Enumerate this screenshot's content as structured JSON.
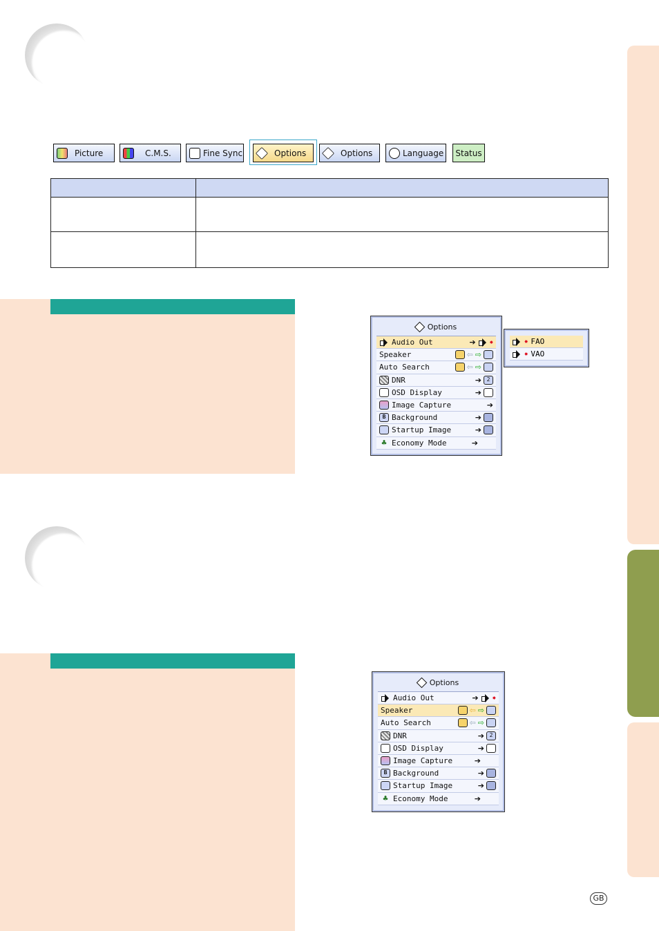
{
  "menu_tabs": {
    "picture": "Picture",
    "cms": "C.M.S.",
    "fine_sync": "Fine Sync",
    "options1": "Options",
    "options2": "Options",
    "language": "Language",
    "status": "Status"
  },
  "osd_top": {
    "title": "Options",
    "items": [
      {
        "label": "Audio Out"
      },
      {
        "label": "Speaker"
      },
      {
        "label": "Auto Search"
      },
      {
        "label": "DNR",
        "value": "2"
      },
      {
        "label": "OSD Display"
      },
      {
        "label": "Image Capture"
      },
      {
        "label": "Background",
        "value": "B"
      },
      {
        "label": "Startup Image"
      },
      {
        "label": "Economy Mode"
      }
    ],
    "submenu": [
      "FAO",
      "VAO"
    ]
  },
  "osd_bottom": {
    "title": "Options",
    "items": [
      {
        "label": "Audio Out"
      },
      {
        "label": "Speaker"
      },
      {
        "label": "Auto Search"
      },
      {
        "label": "DNR",
        "value": "2"
      },
      {
        "label": "OSD Display"
      },
      {
        "label": "Image Capture"
      },
      {
        "label": "Background",
        "value": "B"
      },
      {
        "label": "Startup Image"
      },
      {
        "label": "Economy Mode"
      }
    ]
  },
  "footer": {
    "region_badge": "GB"
  },
  "colors": {
    "peach": "#fce3d1",
    "teal": "#1fa596",
    "olive": "#8f9e4f",
    "table_header": "#cfd9f3"
  }
}
